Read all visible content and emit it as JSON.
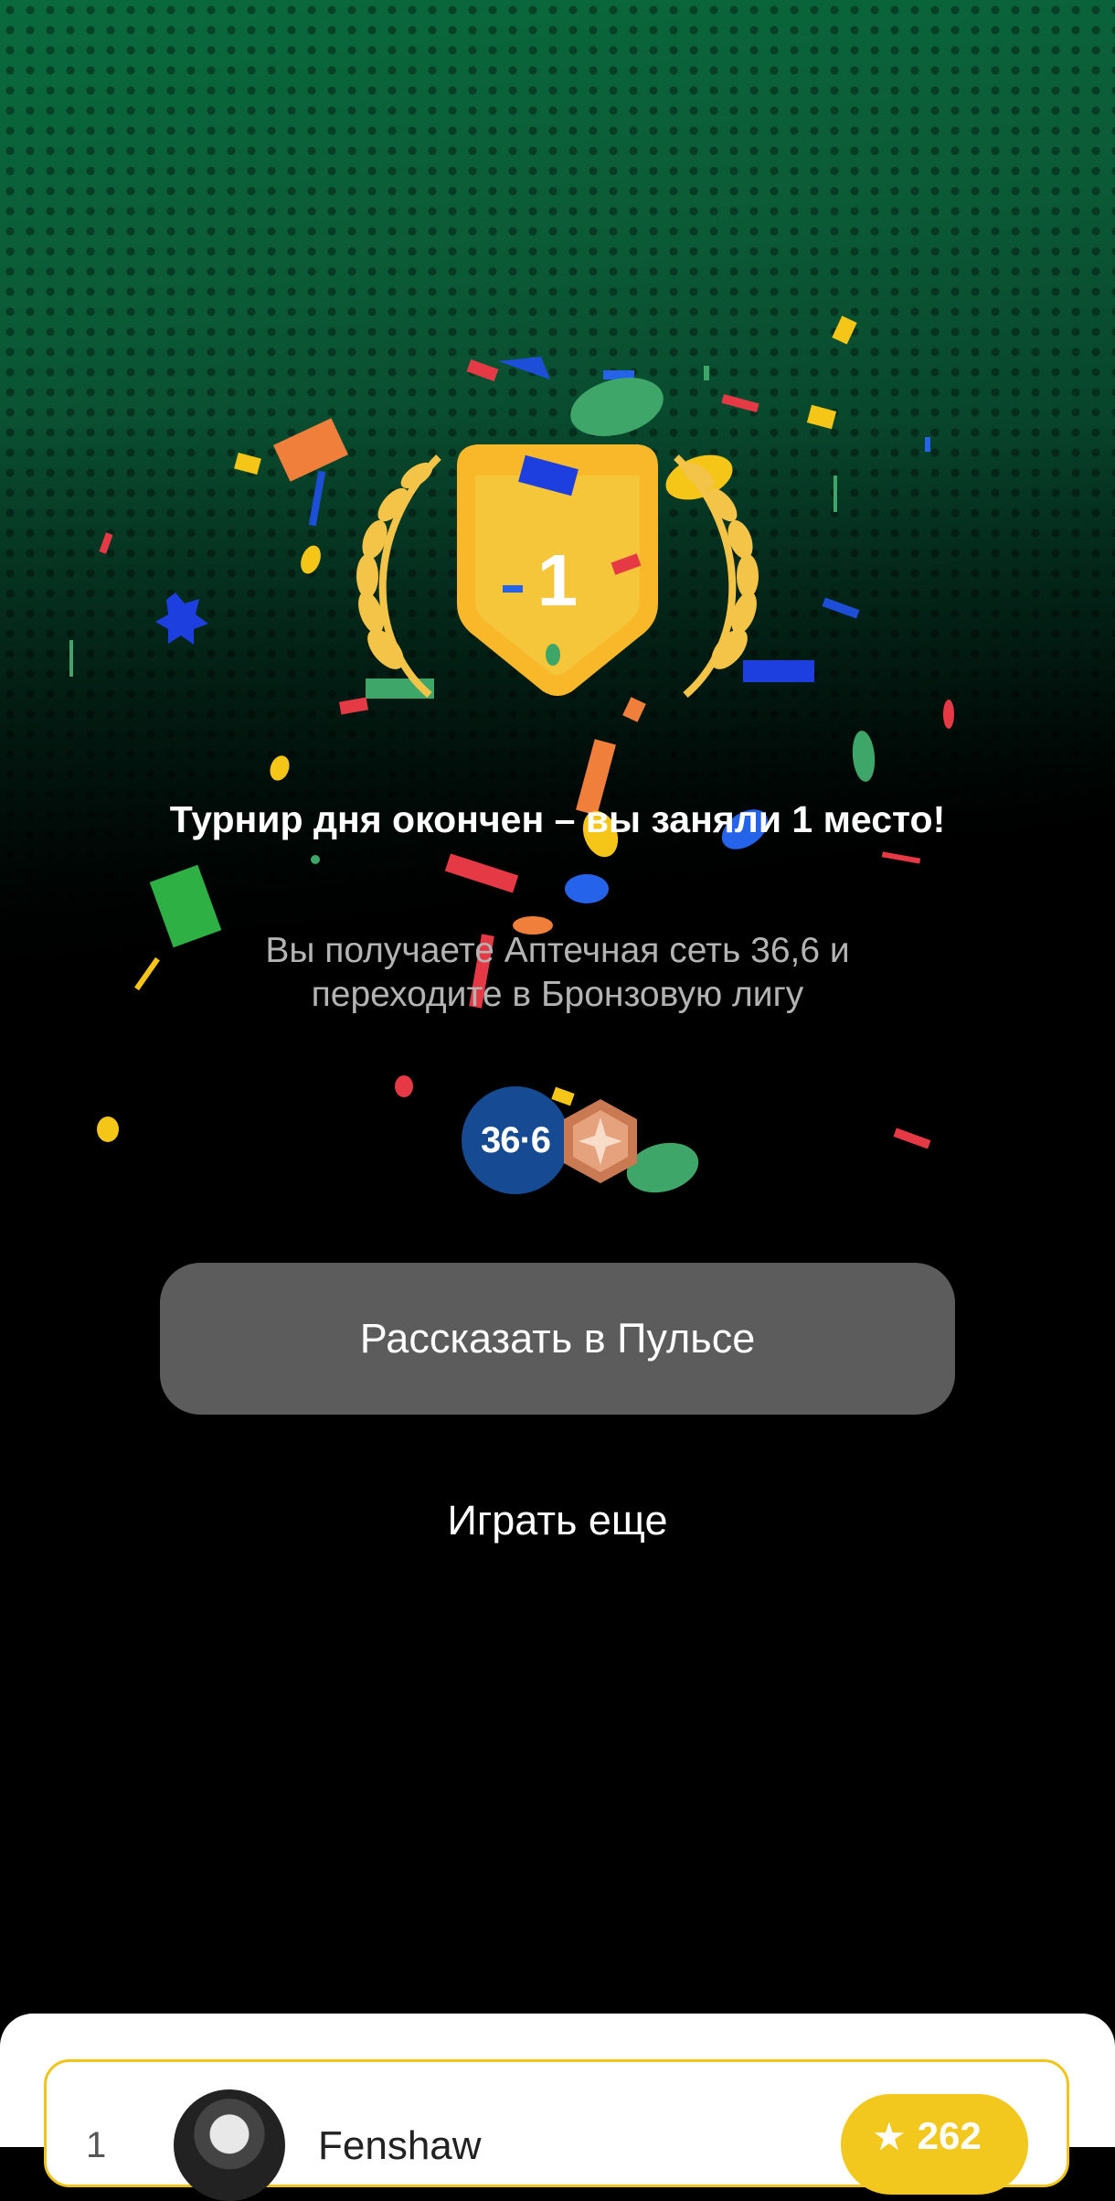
{
  "result": {
    "place_number": "1",
    "title": "Турнир дня окончен – вы заняли 1 место!",
    "subtitle": "Вы получаете Аптечная сеть 36,6 и переходите в Бронзовую лигу"
  },
  "rewards": {
    "partner_logo_text": "36·6",
    "league_icon": "bronze-league-icon"
  },
  "actions": {
    "share_label": "Рассказать в Пульсе",
    "play_again_label": "Играть еще"
  },
  "leaderboard": {
    "rows": [
      {
        "rank": "1",
        "name": "Fenshaw",
        "score": "262"
      }
    ]
  },
  "colors": {
    "accent_yellow": "#f3c81e",
    "button_gray": "#5c5c5c",
    "bronze": "#d28c64",
    "partner_blue": "#164a93"
  }
}
